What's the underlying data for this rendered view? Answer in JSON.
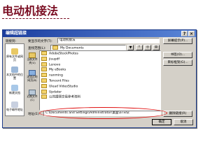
{
  "document": {
    "title": "电动机接法"
  },
  "dialog": {
    "title": "编辑超链接",
    "controls": {
      "help": "?",
      "close": "×"
    },
    "link_to_label": "链接到:",
    "sidebar": [
      {
        "label": "原有文件或网页",
        "color": "#e8c864"
      },
      {
        "label": "本文档中的位置",
        "color": "#9cb8d8"
      },
      {
        "label": "新建文档",
        "color": "#a8c8e8"
      },
      {
        "label": "电子邮件地址",
        "color": "#c8d0e0"
      }
    ],
    "display_text_label": "要显示的文字(T):",
    "display_text_value": "电动机接法",
    "screentip_button": "屏幕提示(P)...",
    "lookin_label": "查找范围(L):",
    "lookin_value": "My Documents",
    "categories": [
      {
        "label": "当前文件夹(U)"
      },
      {
        "label": "浏览过的网页(B)"
      },
      {
        "label": "近期文件(C)"
      }
    ],
    "files": [
      "AdobeStockPhotos",
      "jisupdf",
      "Lenovo",
      "My eBooks",
      "nanming",
      "Tencent Files",
      "Ulead VideoStudio",
      "Updater",
      "公共援颐交易参考资料"
    ],
    "right_buttons": {
      "bookmark": "书签(O)...",
      "target_frame": "目标框架(G)..."
    },
    "address_label": "地址(E):",
    "address_value": "C:\\Documents and Settings\\Administrator\\桌面\\aTxdZ",
    "remove_link": "删除链接(R)",
    "ok": "确定",
    "cancel": "取消"
  }
}
